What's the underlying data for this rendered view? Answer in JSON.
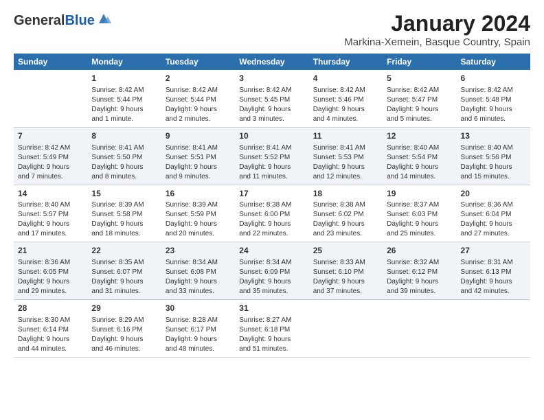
{
  "logo": {
    "general": "General",
    "blue": "Blue"
  },
  "title": "January 2024",
  "subtitle": "Markina-Xemein, Basque Country, Spain",
  "weekdays": [
    "Sunday",
    "Monday",
    "Tuesday",
    "Wednesday",
    "Thursday",
    "Friday",
    "Saturday"
  ],
  "rows": [
    [
      {
        "day": "",
        "info": ""
      },
      {
        "day": "1",
        "info": "Sunrise: 8:42 AM\nSunset: 5:44 PM\nDaylight: 9 hours\nand 1 minute."
      },
      {
        "day": "2",
        "info": "Sunrise: 8:42 AM\nSunset: 5:44 PM\nDaylight: 9 hours\nand 2 minutes."
      },
      {
        "day": "3",
        "info": "Sunrise: 8:42 AM\nSunset: 5:45 PM\nDaylight: 9 hours\nand 3 minutes."
      },
      {
        "day": "4",
        "info": "Sunrise: 8:42 AM\nSunset: 5:46 PM\nDaylight: 9 hours\nand 4 minutes."
      },
      {
        "day": "5",
        "info": "Sunrise: 8:42 AM\nSunset: 5:47 PM\nDaylight: 9 hours\nand 5 minutes."
      },
      {
        "day": "6",
        "info": "Sunrise: 8:42 AM\nSunset: 5:48 PM\nDaylight: 9 hours\nand 6 minutes."
      }
    ],
    [
      {
        "day": "7",
        "info": "Sunrise: 8:42 AM\nSunset: 5:49 PM\nDaylight: 9 hours\nand 7 minutes."
      },
      {
        "day": "8",
        "info": "Sunrise: 8:41 AM\nSunset: 5:50 PM\nDaylight: 9 hours\nand 8 minutes."
      },
      {
        "day": "9",
        "info": "Sunrise: 8:41 AM\nSunset: 5:51 PM\nDaylight: 9 hours\nand 9 minutes."
      },
      {
        "day": "10",
        "info": "Sunrise: 8:41 AM\nSunset: 5:52 PM\nDaylight: 9 hours\nand 11 minutes."
      },
      {
        "day": "11",
        "info": "Sunrise: 8:41 AM\nSunset: 5:53 PM\nDaylight: 9 hours\nand 12 minutes."
      },
      {
        "day": "12",
        "info": "Sunrise: 8:40 AM\nSunset: 5:54 PM\nDaylight: 9 hours\nand 14 minutes."
      },
      {
        "day": "13",
        "info": "Sunrise: 8:40 AM\nSunset: 5:56 PM\nDaylight: 9 hours\nand 15 minutes."
      }
    ],
    [
      {
        "day": "14",
        "info": "Sunrise: 8:40 AM\nSunset: 5:57 PM\nDaylight: 9 hours\nand 17 minutes."
      },
      {
        "day": "15",
        "info": "Sunrise: 8:39 AM\nSunset: 5:58 PM\nDaylight: 9 hours\nand 18 minutes."
      },
      {
        "day": "16",
        "info": "Sunrise: 8:39 AM\nSunset: 5:59 PM\nDaylight: 9 hours\nand 20 minutes."
      },
      {
        "day": "17",
        "info": "Sunrise: 8:38 AM\nSunset: 6:00 PM\nDaylight: 9 hours\nand 22 minutes."
      },
      {
        "day": "18",
        "info": "Sunrise: 8:38 AM\nSunset: 6:02 PM\nDaylight: 9 hours\nand 23 minutes."
      },
      {
        "day": "19",
        "info": "Sunrise: 8:37 AM\nSunset: 6:03 PM\nDaylight: 9 hours\nand 25 minutes."
      },
      {
        "day": "20",
        "info": "Sunrise: 8:36 AM\nSunset: 6:04 PM\nDaylight: 9 hours\nand 27 minutes."
      }
    ],
    [
      {
        "day": "21",
        "info": "Sunrise: 8:36 AM\nSunset: 6:05 PM\nDaylight: 9 hours\nand 29 minutes."
      },
      {
        "day": "22",
        "info": "Sunrise: 8:35 AM\nSunset: 6:07 PM\nDaylight: 9 hours\nand 31 minutes."
      },
      {
        "day": "23",
        "info": "Sunrise: 8:34 AM\nSunset: 6:08 PM\nDaylight: 9 hours\nand 33 minutes."
      },
      {
        "day": "24",
        "info": "Sunrise: 8:34 AM\nSunset: 6:09 PM\nDaylight: 9 hours\nand 35 minutes."
      },
      {
        "day": "25",
        "info": "Sunrise: 8:33 AM\nSunset: 6:10 PM\nDaylight: 9 hours\nand 37 minutes."
      },
      {
        "day": "26",
        "info": "Sunrise: 8:32 AM\nSunset: 6:12 PM\nDaylight: 9 hours\nand 39 minutes."
      },
      {
        "day": "27",
        "info": "Sunrise: 8:31 AM\nSunset: 6:13 PM\nDaylight: 9 hours\nand 42 minutes."
      }
    ],
    [
      {
        "day": "28",
        "info": "Sunrise: 8:30 AM\nSunset: 6:14 PM\nDaylight: 9 hours\nand 44 minutes."
      },
      {
        "day": "29",
        "info": "Sunrise: 8:29 AM\nSunset: 6:16 PM\nDaylight: 9 hours\nand 46 minutes."
      },
      {
        "day": "30",
        "info": "Sunrise: 8:28 AM\nSunset: 6:17 PM\nDaylight: 9 hours\nand 48 minutes."
      },
      {
        "day": "31",
        "info": "Sunrise: 8:27 AM\nSunset: 6:18 PM\nDaylight: 9 hours\nand 51 minutes."
      },
      {
        "day": "",
        "info": ""
      },
      {
        "day": "",
        "info": ""
      },
      {
        "day": "",
        "info": ""
      }
    ]
  ]
}
